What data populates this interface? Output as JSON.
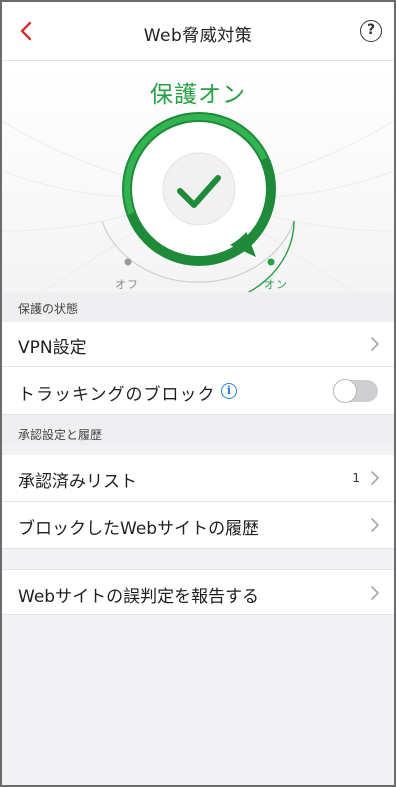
{
  "header": {
    "title": "Web脅威対策",
    "help_glyph": "?"
  },
  "status": {
    "title": "保護オン",
    "off_label": "オフ",
    "on_label": "オン",
    "state": "on"
  },
  "sections": [
    {
      "header": "保護の状態",
      "rows": [
        {
          "label": "VPN設定",
          "type": "link"
        },
        {
          "label": "トラッキングのブロック",
          "type": "toggle",
          "toggle_on": false,
          "info_glyph": "i"
        }
      ]
    },
    {
      "header": "承認設定と履歴",
      "rows": [
        {
          "label": "承認済みリスト",
          "type": "link",
          "count": "1"
        },
        {
          "label": "ブロックしたWebサイトの履歴",
          "type": "link"
        }
      ]
    },
    {
      "header": "",
      "rows": [
        {
          "label": "Webサイトの誤判定を報告する",
          "type": "link"
        }
      ]
    }
  ],
  "colors": {
    "accent_green": "#27a046",
    "back_red": "#d0312d",
    "info_blue": "#2f80d0"
  }
}
